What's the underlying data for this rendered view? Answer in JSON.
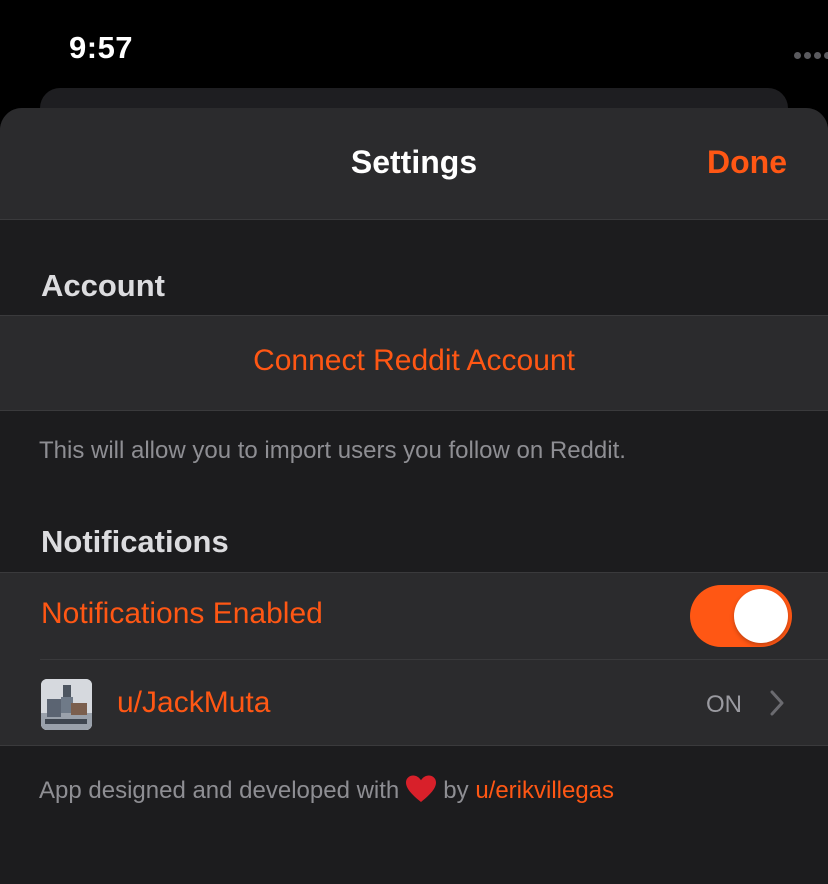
{
  "status_bar": {
    "time": "9:57",
    "icons": [
      "signal-icon",
      "wifi-icon",
      "battery-icon"
    ]
  },
  "nav": {
    "title": "Settings",
    "done_label": "Done"
  },
  "account": {
    "header": "Account",
    "connect_label": "Connect Reddit Account",
    "footer": "This will allow you to import users you follow on Reddit."
  },
  "notifications": {
    "header": "Notifications",
    "enabled_label": "Notifications Enabled",
    "enabled": true,
    "user": {
      "name": "u/JackMuta",
      "status": "ON"
    }
  },
  "credit": {
    "prefix": "App designed and developed with",
    "by": "by",
    "author": "u/erikvillegas"
  },
  "colors": {
    "accent": "#ff5714",
    "background": "#1c1c1e",
    "cell": "#2b2b2d",
    "secondary_text": "#8e8e93"
  }
}
